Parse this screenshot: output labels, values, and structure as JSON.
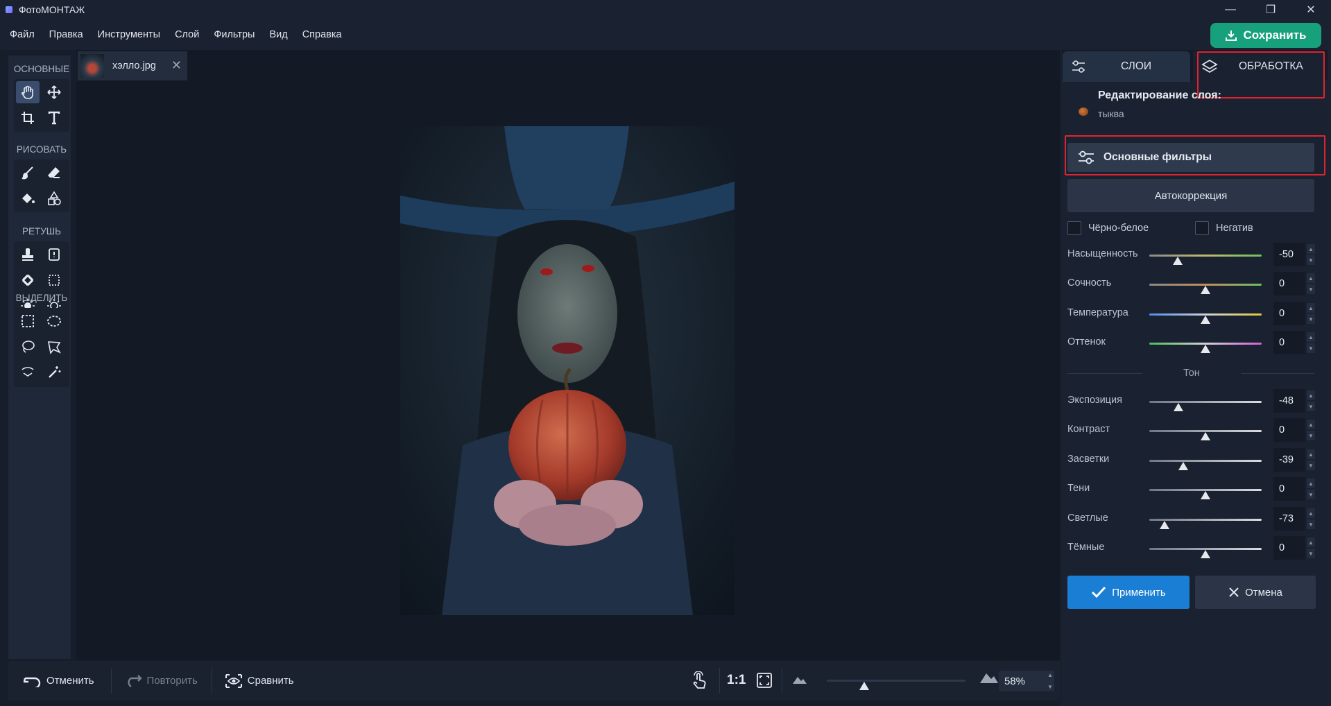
{
  "window": {
    "title": "ФотоМОНТАЖ",
    "minimize": "—",
    "maximize": "❐",
    "close": "✕"
  },
  "menu": [
    "Файл",
    "Правка",
    "Инструменты",
    "Слой",
    "Фильтры",
    "Вид",
    "Справка"
  ],
  "save_label": "Сохранить",
  "toolbox": {
    "sections": [
      "ОСНОВНЫЕ",
      "РИСОВАТЬ",
      "РЕТУШЬ",
      "ВЫДЕЛИТЬ"
    ]
  },
  "document": {
    "tab_name": "хэлло.jpg",
    "close": "✕"
  },
  "bottom": {
    "undo": "Отменить",
    "redo": "Повторить",
    "compare": "Сравнить",
    "one_to_one": "1:1",
    "zoom": "58%",
    "zoom_fraction": 0.27
  },
  "panel": {
    "tab_layers": "СЛОИ",
    "tab_processing": "ОБРАБОТКА",
    "editing_title": "Редактирование слоя:",
    "layer_name": "тыква",
    "basic_filters": "Основные фильтры",
    "autocorrection": "Автокоррекция",
    "bw_label": "Чёрно-белое",
    "negative_label": "Негатив",
    "tone_section": "Тон",
    "apply": "Применить",
    "cancel": "Отмена"
  },
  "sliders": [
    {
      "label": "Насыщенность",
      "value": "-50",
      "min": -100,
      "max": 100,
      "num": -50,
      "track": "sat"
    },
    {
      "label": "Сочность",
      "value": "0",
      "min": -100,
      "max": 100,
      "num": 0,
      "track": "vib"
    },
    {
      "label": "Температура",
      "value": "0",
      "min": -100,
      "max": 100,
      "num": 0,
      "track": "temp"
    },
    {
      "label": "Оттенок",
      "value": "0",
      "min": -100,
      "max": 100,
      "num": 0,
      "track": "tint"
    },
    {
      "label": "Экспозиция",
      "value": "-48",
      "min": -100,
      "max": 100,
      "num": -48,
      "track": "gray"
    },
    {
      "label": "Контраст",
      "value": "0",
      "min": -100,
      "max": 100,
      "num": 0,
      "track": "gray"
    },
    {
      "label": "Засветки",
      "value": "-39",
      "min": -100,
      "max": 100,
      "num": -39,
      "track": "gray"
    },
    {
      "label": "Тени",
      "value": "0",
      "min": -100,
      "max": 100,
      "num": 0,
      "track": "gray"
    },
    {
      "label": "Светлые",
      "value": "-73",
      "min": -100,
      "max": 100,
      "num": -73,
      "track": "gray"
    },
    {
      "label": "Тёмные",
      "value": "0",
      "min": -100,
      "max": 100,
      "num": 0,
      "track": "gray"
    }
  ],
  "colors": {
    "accent": "#17a07c",
    "apply": "#1a7fd4",
    "highlight": "#e0242f"
  }
}
